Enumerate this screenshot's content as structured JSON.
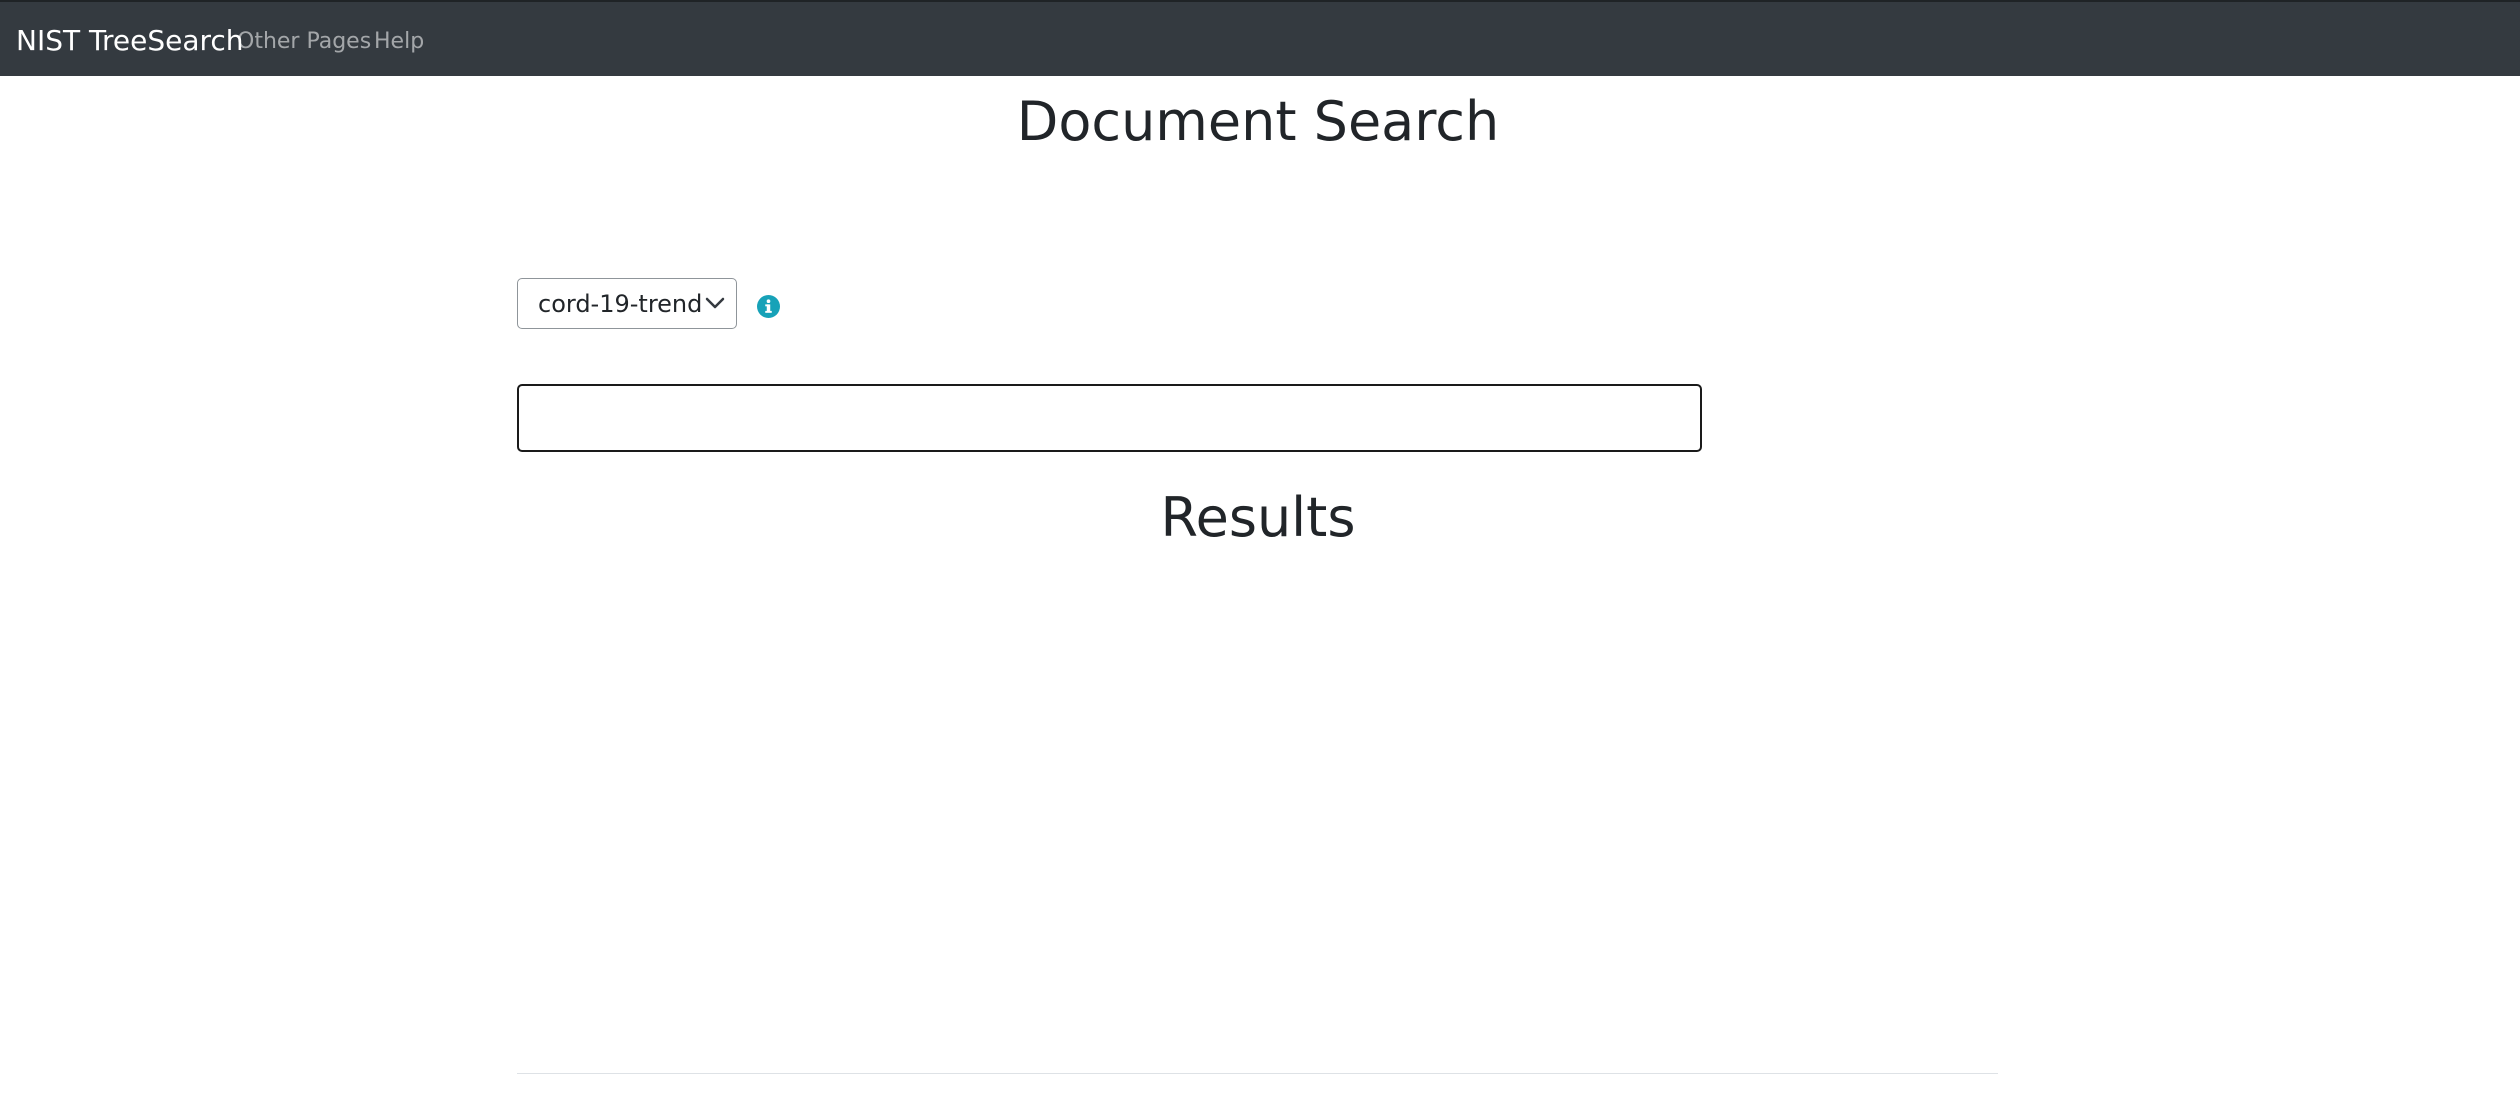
{
  "navbar": {
    "brand": "NIST TreeSearch",
    "links": [
      "Other Pages",
      "Help"
    ],
    "background_color": "#343a40"
  },
  "page": {
    "title": "Document Search",
    "results_title": "Results"
  },
  "search": {
    "collection_selected": "cord-19-trend",
    "query_value": "",
    "info_icon": "info-circle-icon",
    "info_icon_color": "#17a2b8"
  }
}
